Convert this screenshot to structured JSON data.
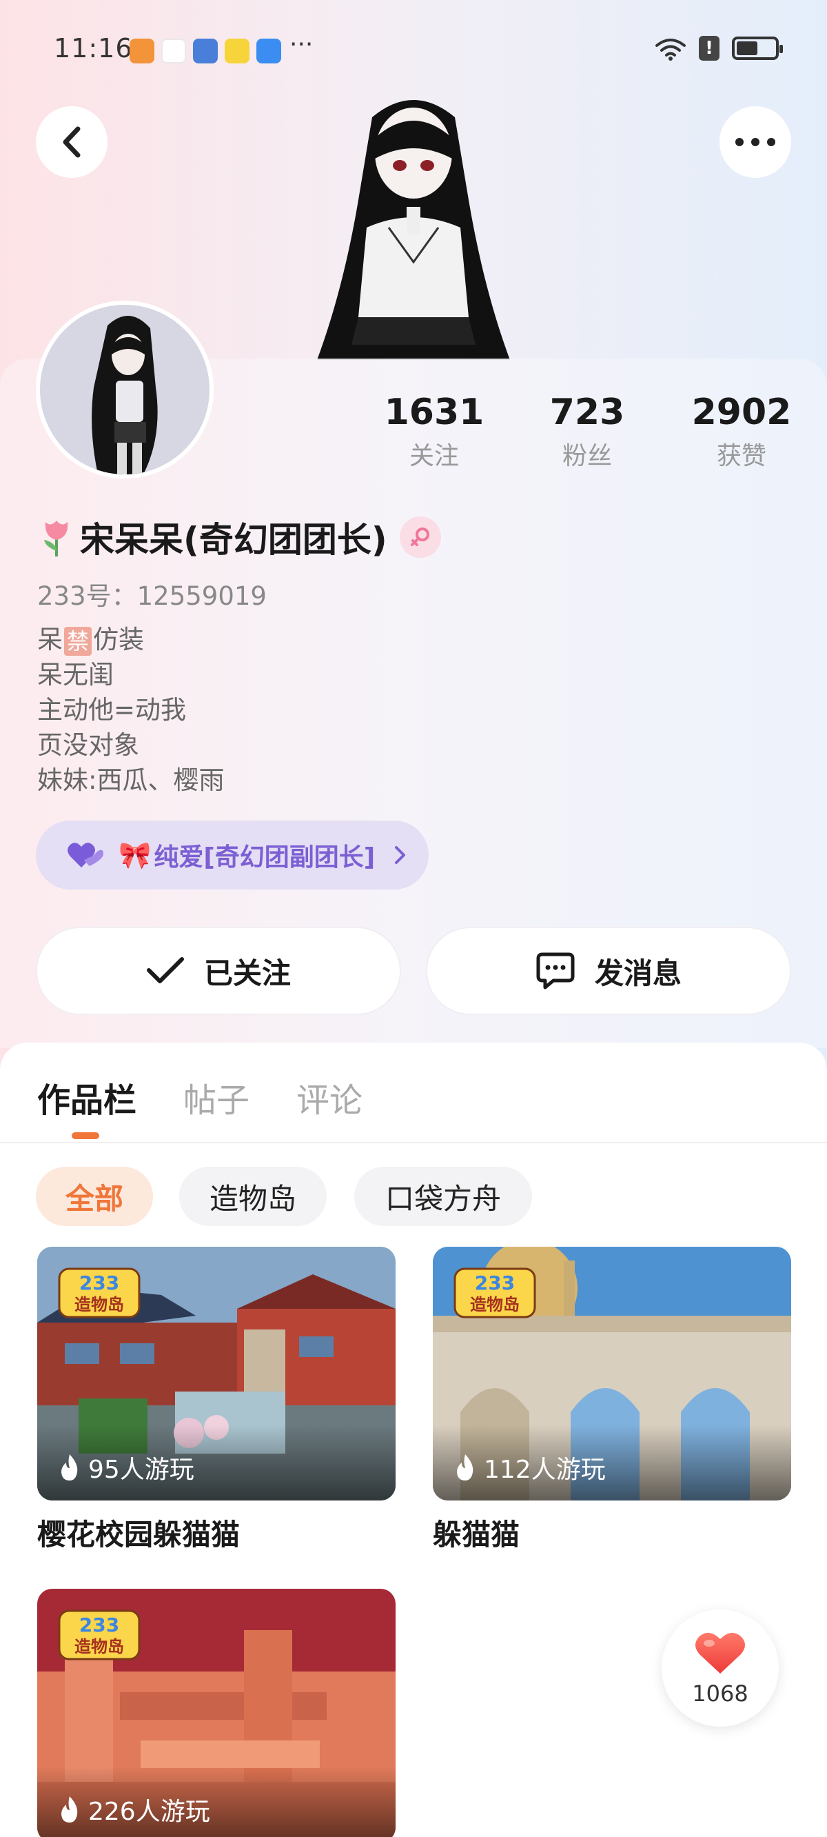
{
  "status_bar": {
    "time": "11:16",
    "dots": "···",
    "alert": "!"
  },
  "profile": {
    "stats": [
      {
        "value": "1631",
        "label": "关注"
      },
      {
        "value": "723",
        "label": "粉丝"
      },
      {
        "value": "2902",
        "label": "获赞"
      }
    ],
    "name": "宋呆呆(奇幻团团长)",
    "id_text": "233号：12559019",
    "bio": {
      "line1_before": "呆",
      "line1_badge": "禁",
      "line1_after": "仿装",
      "line2": "呆无闺",
      "line3": "主动他=动我",
      "line4": "页没对象",
      "line5": "妹妹:西瓜、樱雨"
    },
    "tag": {
      "bow": "🎀",
      "text": "纯爱[奇幻团副团长]"
    },
    "follow_label": "已关注",
    "message_label": "发消息"
  },
  "tabs": [
    {
      "label": "作品栏",
      "active": true
    },
    {
      "label": "帖子",
      "active": false
    },
    {
      "label": "评论",
      "active": false
    }
  ],
  "filters": [
    {
      "label": "全部",
      "active": true
    },
    {
      "label": "造物岛",
      "active": false
    },
    {
      "label": "口袋方舟",
      "active": false
    }
  ],
  "works": [
    {
      "title": "樱花校园躲猫猫",
      "plays": "95人游玩",
      "logo_top": "233",
      "logo_bottom": "造物岛"
    },
    {
      "title": "躲猫猫",
      "plays": "112人游玩",
      "logo_top": "233",
      "logo_bottom": "造物岛"
    },
    {
      "title": "",
      "plays": "226人游玩",
      "logo_top": "233",
      "logo_bottom": "造物岛"
    }
  ],
  "like": {
    "count": "1068"
  },
  "colors": {
    "accent": "#f0763a",
    "tag_text": "#7c5fd3",
    "tag_bg": "#e4dff5",
    "heart": "#f0473e"
  }
}
